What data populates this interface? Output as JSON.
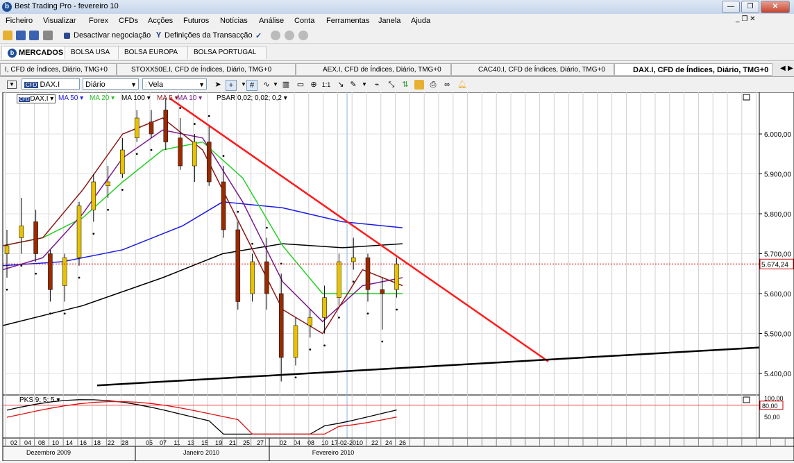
{
  "window": {
    "title": "Best Trading Pro - fevereiro 10",
    "app_icon": "b"
  },
  "menu": [
    "Ficheiro",
    "Visualizar",
    "Forex",
    "CFDs",
    "Acções",
    "Futuros",
    "Notícias",
    "Análise",
    "Conta",
    "Ferramentas",
    "Janela",
    "Ajuda"
  ],
  "toolbar": {
    "deactivate": "Desactivar negociação",
    "settings": "Definições da Transacção"
  },
  "markets": {
    "active": "MERCADOS",
    "tabs": [
      "BOLSA USA",
      "BOLSA EUROPA",
      "BOLSA PORTUGAL"
    ]
  },
  "doc_tabs": [
    "I, CFD de Índices, Diário, TMG+0",
    "STOXX50E.I, CFD de Índices, Diário, TMG+0",
    "AEX.I, CFD de Índices, Diário, TMG+0",
    "CAC40.I, CFD de Índices, Diário, TMG+0",
    "DAX.I, CFD de Índices, Diário, TMG+0"
  ],
  "chart_toolbar": {
    "symbol": "DAX.I",
    "period": "Diário",
    "chart_style": "Vela"
  },
  "indicators": {
    "symbol": "DAX.I",
    "ma50": "MA 50",
    "ma20": "MA 20",
    "ma100": "MA 100",
    "ma5": "MA 5",
    "ma10": "MA 10",
    "psar": "PSAR 0,02; 0,02; 0,2",
    "pks": "PKS 9; 5; 5"
  },
  "colors": {
    "ma50": "#1a1ae6",
    "ma20": "#22d022",
    "ma100": "#000000",
    "ma5": "#8b1a1a",
    "ma10": "#7a1a8b",
    "trend": "#ff1a1a",
    "candle_up": "#e8c200",
    "candle_down": "#9a2a00"
  },
  "chart_data": {
    "type": "candlestick",
    "y_ticks": [
      "6.000,00",
      "5.900,00",
      "5.800,00",
      "5.700,00",
      "5.600,00",
      "5.500,00",
      "5.400,00"
    ],
    "y_tick_values": [
      6000,
      5900,
      5800,
      5700,
      5600,
      5500,
      5400
    ],
    "current_price_label": "5.674,24",
    "current_price": 5674.24,
    "ylim": [
      5350,
      6100
    ],
    "x_day_labels": [
      "02",
      "04",
      "08",
      "10",
      "14",
      "16",
      "18",
      "22",
      "28",
      "05",
      "07",
      "11",
      "13",
      "15",
      "19",
      "21",
      "25",
      "27",
      "02",
      "04",
      "08",
      "10",
      "17-02-2010",
      "22",
      "24",
      "26"
    ],
    "x_months": [
      "Dezembro 2009",
      "Janeiro 2010",
      "Fevereiro 2010"
    ],
    "candles": [
      {
        "o": 5700,
        "h": 5760,
        "l": 5640,
        "c": 5720
      },
      {
        "o": 5740,
        "h": 5840,
        "l": 5700,
        "c": 5770
      },
      {
        "o": 5780,
        "h": 5810,
        "l": 5680,
        "c": 5700
      },
      {
        "o": 5700,
        "h": 5710,
        "l": 5580,
        "c": 5610
      },
      {
        "o": 5620,
        "h": 5700,
        "l": 5580,
        "c": 5690
      },
      {
        "o": 5690,
        "h": 5830,
        "l": 5670,
        "c": 5820
      },
      {
        "o": 5810,
        "h": 5900,
        "l": 5780,
        "c": 5880
      },
      {
        "o": 5870,
        "h": 5920,
        "l": 5840,
        "c": 5880
      },
      {
        "o": 5900,
        "h": 5990,
        "l": 5890,
        "c": 5960
      },
      {
        "o": 5990,
        "h": 6060,
        "l": 5980,
        "c": 6040
      },
      {
        "o": 6030,
        "h": 6060,
        "l": 5990,
        "c": 6000
      },
      {
        "o": 6060,
        "h": 6090,
        "l": 5960,
        "c": 5980
      },
      {
        "o": 5990,
        "h": 6040,
        "l": 5910,
        "c": 5920
      },
      {
        "o": 5920,
        "h": 6000,
        "l": 5880,
        "c": 5980
      },
      {
        "o": 5980,
        "h": 6020,
        "l": 5870,
        "c": 5880
      },
      {
        "o": 5880,
        "h": 5920,
        "l": 5740,
        "c": 5760
      },
      {
        "o": 5760,
        "h": 5780,
        "l": 5560,
        "c": 5580
      },
      {
        "o": 5600,
        "h": 5700,
        "l": 5580,
        "c": 5680
      },
      {
        "o": 5680,
        "h": 5740,
        "l": 5560,
        "c": 5600
      },
      {
        "o": 5600,
        "h": 5650,
        "l": 5380,
        "c": 5440
      },
      {
        "o": 5440,
        "h": 5540,
        "l": 5420,
        "c": 5520
      },
      {
        "o": 5520,
        "h": 5560,
        "l": 5490,
        "c": 5540
      },
      {
        "o": 5540,
        "h": 5620,
        "l": 5500,
        "c": 5590
      },
      {
        "o": 5590,
        "h": 5700,
        "l": 5570,
        "c": 5680
      },
      {
        "o": 5680,
        "h": 5740,
        "l": 5660,
        "c": 5690
      },
      {
        "o": 5690,
        "h": 5700,
        "l": 5580,
        "c": 5610
      },
      {
        "o": 5610,
        "h": 5640,
        "l": 5510,
        "c": 5600
      },
      {
        "o": 5610,
        "h": 5690,
        "l": 5590,
        "c": 5674
      }
    ],
    "lines": {
      "ma100": [
        [
          0,
          5520
        ],
        [
          0.2,
          5570
        ],
        [
          0.4,
          5640
        ],
        [
          0.55,
          5700
        ],
        [
          0.7,
          5725
        ],
        [
          0.85,
          5715
        ],
        [
          1,
          5725
        ]
      ],
      "ma50": [
        [
          0,
          5670
        ],
        [
          0.15,
          5680
        ],
        [
          0.3,
          5710
        ],
        [
          0.45,
          5770
        ],
        [
          0.55,
          5830
        ],
        [
          0.7,
          5815
        ],
        [
          0.85,
          5780
        ],
        [
          1,
          5765
        ]
      ],
      "ma20": [
        [
          0,
          5720
        ],
        [
          0.1,
          5740
        ],
        [
          0.2,
          5790
        ],
        [
          0.3,
          5880
        ],
        [
          0.4,
          5960
        ],
        [
          0.5,
          5980
        ],
        [
          0.6,
          5890
        ],
        [
          0.7,
          5720
        ],
        [
          0.8,
          5600
        ],
        [
          0.9,
          5600
        ],
        [
          1,
          5600
        ]
      ],
      "ma10": [
        [
          0,
          5660
        ],
        [
          0.1,
          5690
        ],
        [
          0.2,
          5800
        ],
        [
          0.3,
          5940
        ],
        [
          0.4,
          6010
        ],
        [
          0.5,
          5990
        ],
        [
          0.6,
          5830
        ],
        [
          0.7,
          5630
        ],
        [
          0.8,
          5530
        ],
        [
          0.9,
          5620
        ],
        [
          1,
          5640
        ]
      ],
      "ma5": [
        [
          0,
          5720
        ],
        [
          0.1,
          5740
        ],
        [
          0.2,
          5860
        ],
        [
          0.3,
          6000
        ],
        [
          0.4,
          6040
        ],
        [
          0.5,
          5960
        ],
        [
          0.6,
          5760
        ],
        [
          0.7,
          5560
        ],
        [
          0.8,
          5500
        ],
        [
          0.9,
          5660
        ],
        [
          1,
          5620
        ]
      ]
    },
    "oscillator": {
      "upper_level_label": "80,00",
      "ticks": [
        "100,00",
        "50,00"
      ]
    },
    "grid": true
  }
}
